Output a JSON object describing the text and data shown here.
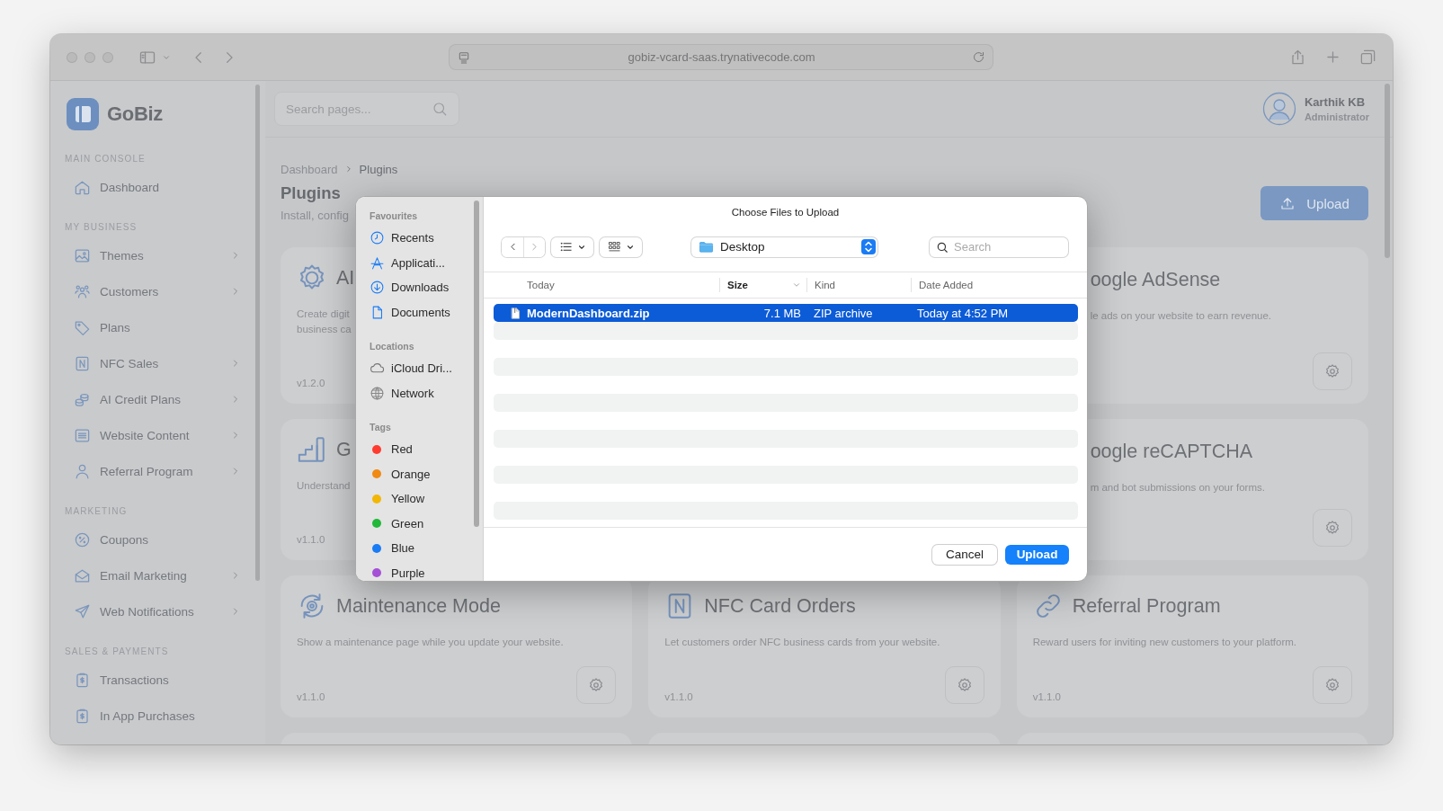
{
  "browser": {
    "url": "gobiz-vcard-saas.trynativecode.com"
  },
  "sidebar": {
    "brand": "GoBiz",
    "sections": [
      {
        "heading": "MAIN CONSOLE",
        "items": [
          {
            "label": "Dashboard",
            "expandable": false
          }
        ]
      },
      {
        "heading": "MY BUSINESS",
        "items": [
          {
            "label": "Themes",
            "expandable": true
          },
          {
            "label": "Customers",
            "expandable": true
          },
          {
            "label": "Plans",
            "expandable": false
          },
          {
            "label": "NFC Sales",
            "expandable": true
          },
          {
            "label": "AI Credit Plans",
            "expandable": true
          },
          {
            "label": "Website Content",
            "expandable": true
          },
          {
            "label": "Referral Program",
            "expandable": true
          }
        ]
      },
      {
        "heading": "MARKETING",
        "items": [
          {
            "label": "Coupons",
            "expandable": false
          },
          {
            "label": "Email Marketing",
            "expandable": true
          },
          {
            "label": "Web Notifications",
            "expandable": true
          }
        ]
      },
      {
        "heading": "SALES & PAYMENTS",
        "items": [
          {
            "label": "Transactions",
            "expandable": false
          },
          {
            "label": "In App Purchases",
            "expandable": false
          }
        ]
      }
    ]
  },
  "header": {
    "search_placeholder": "Search pages...",
    "user": {
      "name": "Karthik KB",
      "role": "Administrator"
    }
  },
  "page": {
    "breadcrumb": [
      "Dashboard",
      "Plugins"
    ],
    "title": "Plugins",
    "subtitle": "Install, config",
    "upload_button": "Upload"
  },
  "cards": [
    {
      "kind": "left",
      "title": "AI",
      "description": [
        "Create digit",
        "business ca"
      ],
      "version": "v1.2.0"
    },
    {
      "kind": "right",
      "title": "oogle AdSense",
      "description": [
        "le ads on your website to earn revenue."
      ]
    },
    {
      "kind": "left",
      "title": "G",
      "description": [
        "Understand"
      ],
      "version": "v1.1.0"
    },
    {
      "kind": "right",
      "title": "oogle reCAPTCHA",
      "description": [
        "m and bot submissions on your forms."
      ]
    },
    {
      "kind": "full",
      "title": "Maintenance Mode",
      "description": [
        "Show a maintenance page while you update your website."
      ],
      "version": "v1.1.0"
    },
    {
      "kind": "full",
      "title": "NFC Card Orders",
      "description": [
        "Let customers order NFC business cards from your website."
      ],
      "version": "v1.1.0"
    },
    {
      "kind": "full",
      "title": "Referral Program",
      "description": [
        "Reward users for inviting new customers to your platform."
      ],
      "version": "v1.1.0"
    },
    {
      "kind": "cut"
    },
    {
      "kind": "cut"
    },
    {
      "kind": "cut"
    }
  ],
  "file_dialog": {
    "title": "Choose Files to Upload",
    "sidebar": [
      {
        "heading": "Favourites",
        "items": [
          {
            "label": "Recents"
          },
          {
            "label": "Applicati..."
          },
          {
            "label": "Downloads"
          },
          {
            "label": "Documents"
          }
        ]
      },
      {
        "heading": "Locations",
        "items": [
          {
            "label": "iCloud Dri..."
          },
          {
            "label": "Network"
          }
        ]
      },
      {
        "heading": "Tags",
        "items": [
          {
            "label": "Red",
            "color": "#ff3b30"
          },
          {
            "label": "Orange",
            "color": "#f08a12"
          },
          {
            "label": "Yellow",
            "color": "#f2b705"
          },
          {
            "label": "Green",
            "color": "#22b83a"
          },
          {
            "label": "Blue",
            "color": "#1a7cf5"
          },
          {
            "label": "Purple",
            "color": "#a550d6"
          }
        ]
      }
    ],
    "location": "Desktop",
    "search_placeholder": "Search",
    "columns": [
      {
        "label": "Today",
        "sorted": false
      },
      {
        "label": "Size",
        "sorted": true
      },
      {
        "label": "Kind",
        "sorted": false
      },
      {
        "label": "Date Added",
        "sorted": false
      }
    ],
    "files": [
      {
        "name": "ModernDashboard.zip",
        "size": "7.1 MB",
        "file_kind": "ZIP archive",
        "date_added": "Today at 4:52 PM",
        "selected": true
      }
    ],
    "cancel_button": "Cancel",
    "confirm_button": "Upload"
  }
}
